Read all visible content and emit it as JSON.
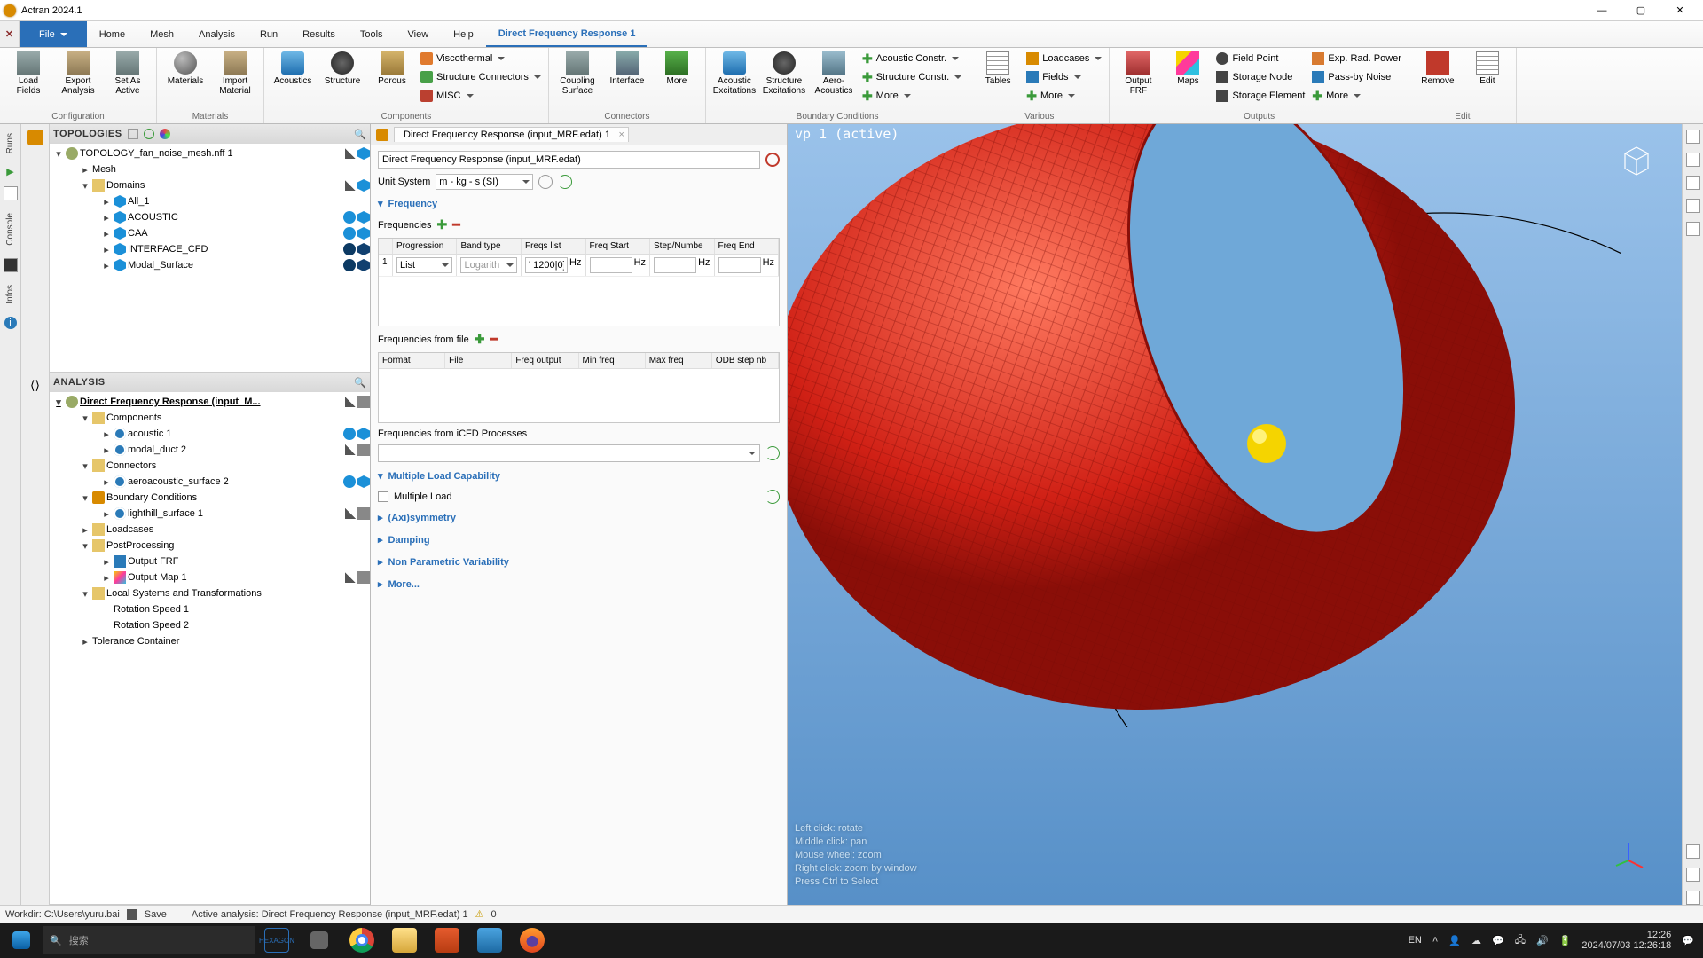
{
  "titlebar": {
    "app_title": "Actran 2024.1"
  },
  "menu": {
    "file": "File",
    "items": [
      "Home",
      "Mesh",
      "Analysis",
      "Run",
      "Results",
      "Tools",
      "View",
      "Help"
    ],
    "active_tab": "Direct Frequency Response 1"
  },
  "ribbon": {
    "configuration": {
      "label": "Configuration",
      "load_fields": "Load\nFields",
      "export_analysis": "Export\nAnalysis",
      "set_as_active": "Set As\nActive"
    },
    "materials": {
      "label": "Materials",
      "materials": "Materials",
      "import_material": "Import\nMaterial"
    },
    "components": {
      "label": "Components",
      "acoustics": "Acoustics",
      "structure": "Structure",
      "porous": "Porous",
      "viscothermal": "Viscothermal",
      "structure_connectors": "Structure Connectors",
      "misc": "MISC"
    },
    "connectors": {
      "label": "Connectors",
      "coupling_surface": "Coupling\nSurface",
      "interface": "Interface",
      "more": "More"
    },
    "excitations": {
      "label": "Boundary Conditions",
      "acoustic_exc": "Acoustic\nExcitations",
      "structure_exc": "Structure\nExcitations",
      "aero_acoustics": "Aero-\nAcoustics",
      "acoustic_constr": "Acoustic Constr.",
      "structure_constr": "Structure Constr.",
      "more": "More"
    },
    "various": {
      "label": "Various",
      "tables": "Tables",
      "loadcases": "Loadcases",
      "fields": "Fields",
      "more": "More"
    },
    "outputs": {
      "label": "Outputs",
      "output_frf": "Output\nFRF",
      "maps": "Maps",
      "field_point": "Field Point",
      "storage_node": "Storage Node",
      "storage_element": "Storage Element",
      "exp_rad_power": "Exp. Rad. Power",
      "pass_by_noise": "Pass-by Noise",
      "more": "More"
    },
    "edit": {
      "label": "Edit",
      "remove": "Remove",
      "edit": "Edit"
    }
  },
  "left_tabs": {
    "runs": "Runs",
    "console": "Console",
    "infos": "Infos"
  },
  "topologies": {
    "title": "TOPOLOGIES",
    "root": "TOPOLOGY_fan_noise_mesh.nff 1",
    "mesh": "Mesh",
    "domains": "Domains",
    "items": [
      "All_1",
      "ACOUSTIC",
      "CAA",
      "INTERFACE_CFD",
      "Modal_Surface"
    ]
  },
  "analysis": {
    "title": "ANALYSIS",
    "root": "Direct Frequency Response (input_M...",
    "components": "Components",
    "comp_items": [
      "acoustic 1",
      "modal_duct 2"
    ],
    "connectors": "Connectors",
    "conn_items": [
      "aeroacoustic_surface 2"
    ],
    "boundary": "Boundary Conditions",
    "bc_items": [
      "lighthill_surface 1"
    ],
    "loadcases": "Loadcases",
    "postprocessing": "PostProcessing",
    "pp_items": [
      "Output FRF",
      "Output Map 1"
    ],
    "localsys": "Local Systems and Transformations",
    "ls_items": [
      "Rotation Speed 1",
      "Rotation Speed 2"
    ],
    "tolerance": "Tolerance Container"
  },
  "form": {
    "tab": "Direct Frequency Response (input_MRF.edat) 1",
    "name_field": "Direct Frequency Response (input_MRF.edat)",
    "unit_system_label": "Unit System",
    "unit_system_value": "m - kg - s (SI)",
    "sec_frequency": "Frequency",
    "frequencies_label": "Frequencies",
    "tbl1_headers": [
      "",
      "Progression",
      "Band type",
      "Freqs list",
      "Freq Start",
      "Step/Numbe",
      "Freq End"
    ],
    "row1": {
      "idx": "1",
      "progression": "List",
      "band": "Logarith",
      "freqs": "' 1200|0]",
      "u": "Hz"
    },
    "freq_from_file": "Frequencies from file",
    "tbl2_headers": [
      "Format",
      "File",
      "Freq output",
      "Min freq",
      "Max freq",
      "ODB step nb"
    ],
    "freq_icfd": "Frequencies from iCFD Processes",
    "sec_multiload": "Multiple Load Capability",
    "multiload_label": "Multiple Load",
    "sec_axi": "(Axi)symmetry",
    "sec_damping": "Damping",
    "sec_npv": "Non Parametric Variability",
    "sec_more": "More..."
  },
  "viewport": {
    "title": "vp 1 (active)",
    "hints": [
      "Left click: rotate",
      "Middle click: pan",
      "Mouse wheel: zoom",
      "Right click: zoom by window",
      "Press Ctrl to Select"
    ]
  },
  "status": {
    "workdir": "Workdir: C:\\Users\\yuru.bai",
    "save": "Save",
    "active": "Active analysis: Direct Frequency Response (input_MRF.edat) 1",
    "warn_count": "0"
  },
  "taskbar": {
    "search_placeholder": "搜索",
    "lang": "EN",
    "time": "12:26",
    "date": "2024/07/03 12:26:18"
  }
}
